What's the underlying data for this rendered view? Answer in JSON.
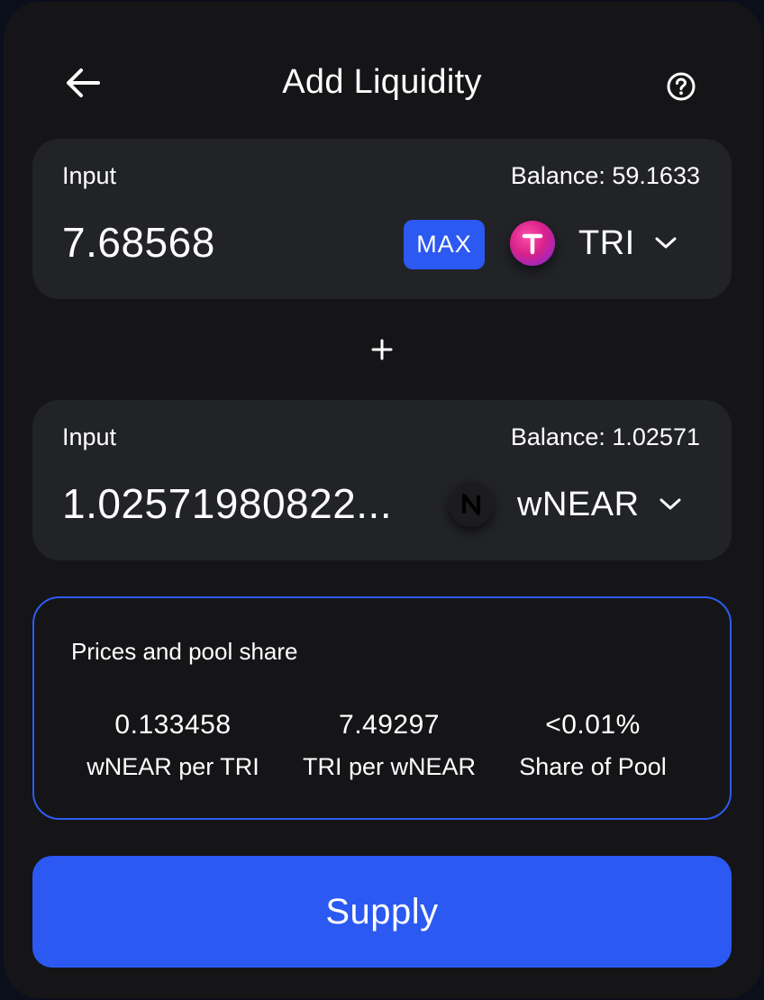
{
  "header": {
    "title": "Add Liquidity",
    "back_icon": "arrow-left-icon",
    "help_icon": "question-circle-icon"
  },
  "input_a": {
    "label": "Input",
    "balance": "Balance: 59.1633",
    "amount": "7.68568",
    "max_label": "MAX",
    "token_symbol": "TRI",
    "token_icon_letter": "T",
    "token_icon": "tri-token-icon"
  },
  "separator_icon": "plus-icon",
  "input_b": {
    "label": "Input",
    "balance": "Balance: 1.02571",
    "amount": "1.02571980822...",
    "token_symbol": "wNEAR",
    "token_icon": "near-token-icon"
  },
  "prices": {
    "title": "Prices and pool share",
    "stats": [
      {
        "value": "0.133458",
        "label": "wNEAR per TRI"
      },
      {
        "value": "7.49297",
        "label": "TRI per wNEAR"
      },
      {
        "value": "<0.01%",
        "label": "Share of Pool"
      }
    ]
  },
  "supply_label": "Supply",
  "colors": {
    "card_bg": "#151518",
    "panel_bg": "#222327",
    "accent_blue": "#2b59f2",
    "page_bg": "#0b0f1c"
  }
}
